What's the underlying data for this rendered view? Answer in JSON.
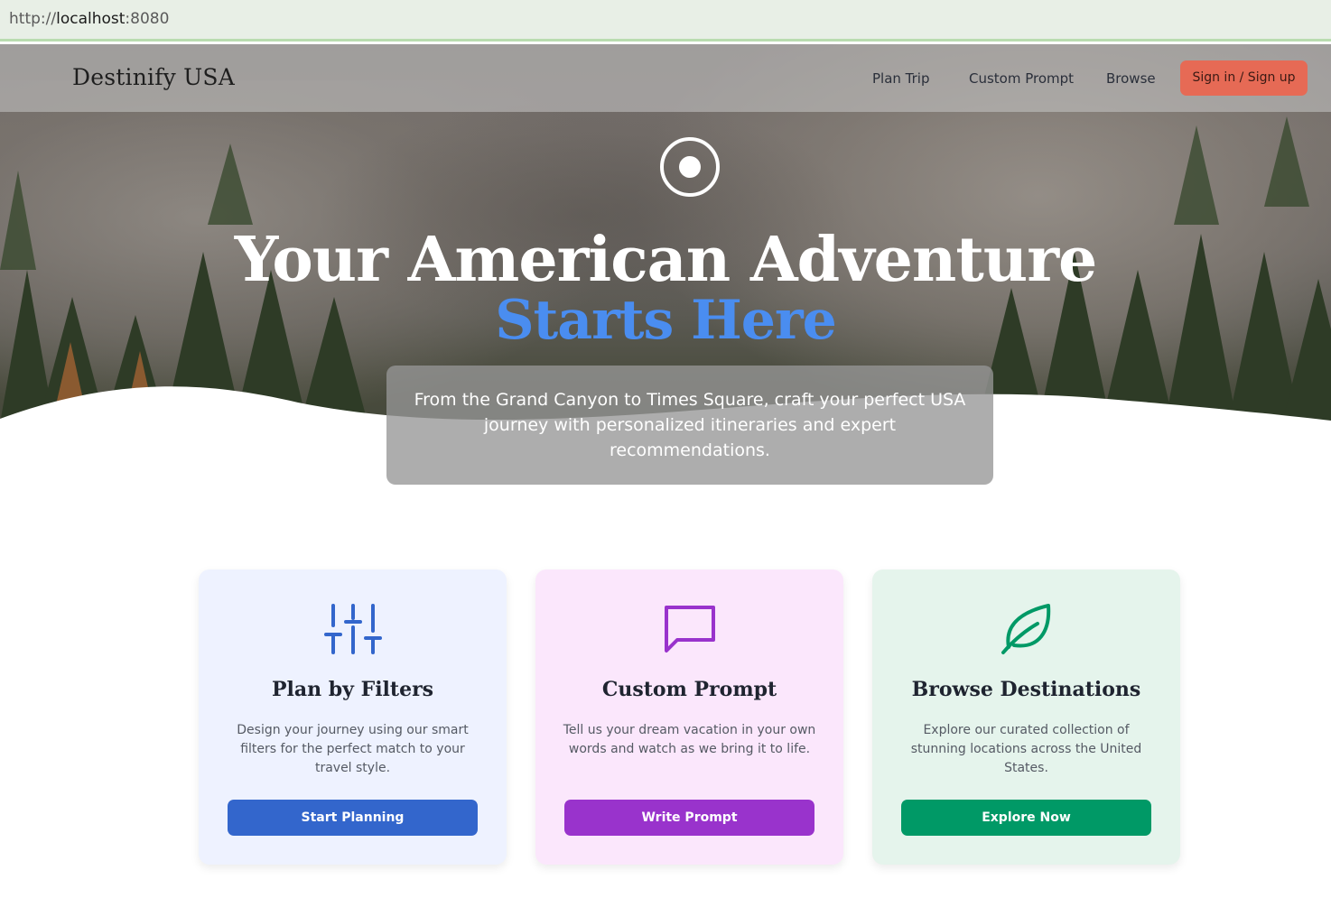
{
  "browser": {
    "url_prefix": "http://",
    "url_host": "localhost",
    "url_port": ":8080"
  },
  "nav": {
    "brand": "Destinify USA",
    "links": [
      "Plan Trip",
      "Custom Prompt",
      "Browse"
    ],
    "signin": "Sign in / Sign up"
  },
  "hero": {
    "title_line1": "Your American Adventure",
    "title_line2": "Starts Here",
    "subtitle": "From the Grand Canyon to Times Square, craft your perfect USA journey with personalized itineraries and expert recommendations."
  },
  "cards": [
    {
      "icon": "sliders-icon",
      "title": "Plan by Filters",
      "desc": "Design your journey using our smart filters for the perfect match to your travel style.",
      "button": "Start Planning",
      "bg": "#eef2ff",
      "accent": "#3366cc"
    },
    {
      "icon": "message-square-icon",
      "title": "Custom Prompt",
      "desc": "Tell us your dream vacation in your own words and watch as we bring it to life.",
      "button": "Write Prompt",
      "bg": "#fbe7fc",
      "accent": "#9933cc"
    },
    {
      "icon": "leaf-icon",
      "title": "Browse Destinations",
      "desc": "Explore our curated collection of stunning locations across the United States.",
      "button": "Explore Now",
      "bg": "#e5f4ec",
      "accent": "#009966"
    }
  ],
  "colors": {
    "signin_bg": "#e66a55",
    "hero_accent": "#4a8df0"
  }
}
